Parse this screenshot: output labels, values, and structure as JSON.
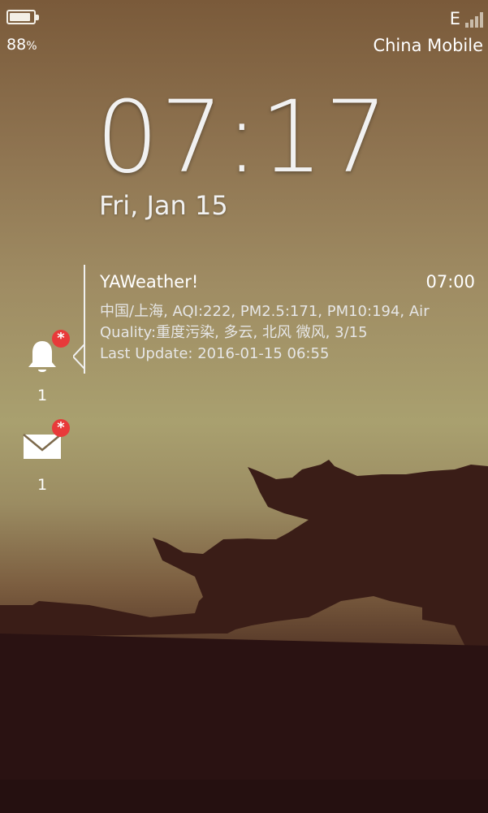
{
  "status": {
    "battery_pct": "88",
    "battery_unit": "%",
    "battery_level": 0.88,
    "network_type": "E",
    "signal_bars": 4,
    "carrier": "China Mobile"
  },
  "clock": {
    "time": "07:17",
    "date": "Fri, Jan 15"
  },
  "notification": {
    "app": "YAWeather!",
    "time": "07:00",
    "line1": "中国/上海, AQI:222, PM2.5:171, PM10:194, Air",
    "line2": "Quality:重度污染, 多云, 北风 微风, 3/15",
    "line3": "Last Update: 2016-01-15 06:55"
  },
  "hub": {
    "reminders": {
      "icon": "bell-icon",
      "count": "1",
      "badge": "*"
    },
    "messages": {
      "icon": "envelope-icon",
      "count": "1",
      "badge": "*"
    }
  },
  "colors": {
    "badge": "#e83a3a",
    "text": "#ffffff"
  }
}
